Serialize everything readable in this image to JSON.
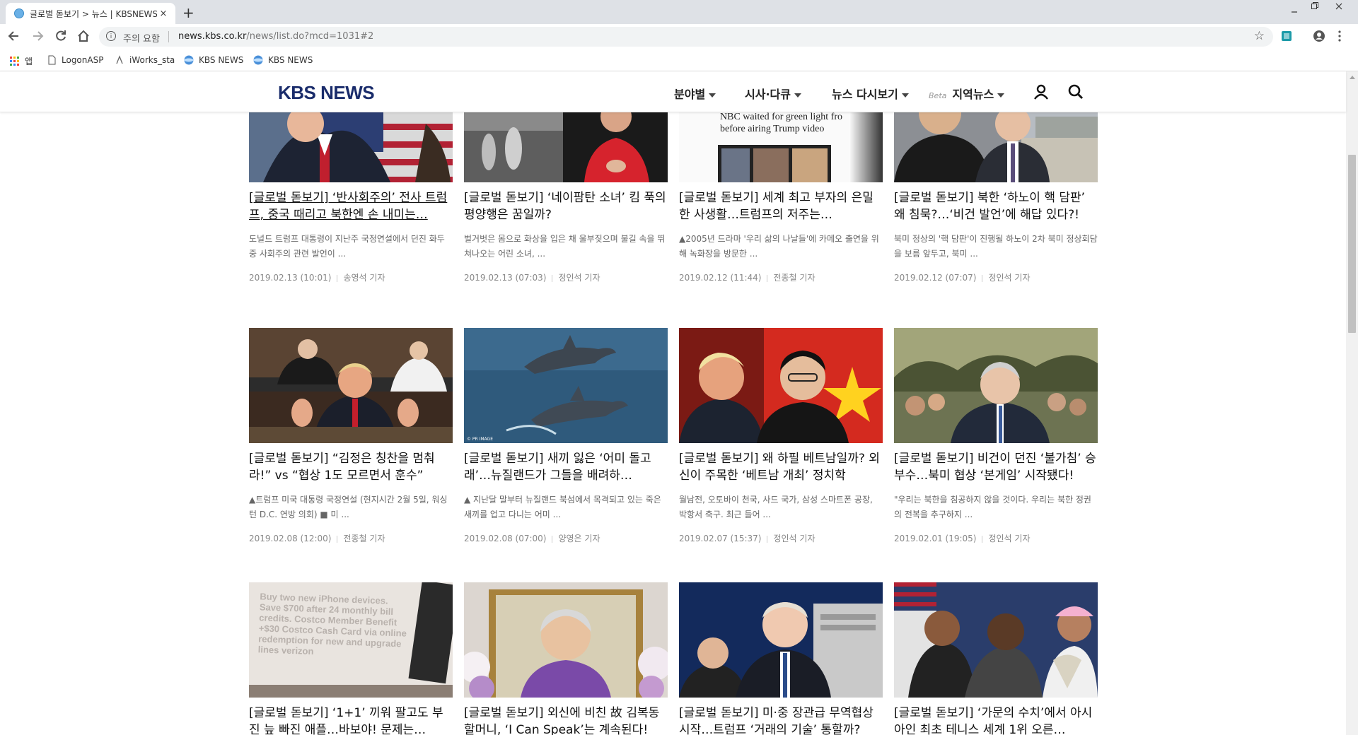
{
  "browser": {
    "tab_title": "글로벌 돋보기 > 뉴스 | KBSNEWS",
    "tab_close": "×",
    "new_tab": "+",
    "security_label": "주의 요함",
    "url_host": "news.kbs.co.kr",
    "url_path": "/news/list.do?mcd=1031#2",
    "bookmarks": [
      {
        "label": "앱",
        "icon": "apps-grid-icon"
      },
      {
        "label": "LogonASP",
        "icon": "page-icon"
      },
      {
        "label": "iWorks_sta",
        "icon": "iworks-icon"
      },
      {
        "label": "KBS NEWS",
        "icon": "kbs-globe-icon"
      },
      {
        "label": "KBS NEWS",
        "icon": "kbs-globe-icon"
      }
    ]
  },
  "site": {
    "logo": "KBS NEWS",
    "menu": [
      {
        "label": "분야별"
      },
      {
        "label": "시사·다큐"
      },
      {
        "label": "뉴스 다시보기"
      },
      {
        "label": "지역뉴스",
        "badge": "Beta"
      }
    ],
    "accent_color": "#1a2c6b"
  },
  "articles": [
    {
      "headline": "[글로벌 돋보기] ‘반사회주의’ 전사 트럼프, 중국 때리고 북한엔 손 내미는…",
      "excerpt": "도널드 트럼프 대통령이 지난주 국정연설에서 던진 화두 중 사회주의 관련 발언이 ...",
      "date": "2019.02.13 (10:01)",
      "reporter": "송영석 기자",
      "underline": true
    },
    {
      "headline": "[글로벌 돋보기] ‘네이팜탄 소녀’ 킴 푹의 평양행은 꿈일까?",
      "excerpt": "벌거벗은 몸으로 화상을 입은 채 울부짖으며 불길 속을 뛰쳐나오는 어린 소녀, ...",
      "date": "2019.02.13 (07:03)",
      "reporter": "정인석 기자",
      "underline": false
    },
    {
      "headline": "[글로벌 돋보기] 세계 최고 부자의 은밀한 사생활…트럼프의 저주는…",
      "excerpt": "▲2005년 드라마 '우리 삶의 나날들'에 카메오 출연을 위해 녹화장을 방문한 ...",
      "date": "2019.02.12 (11:44)",
      "reporter": "전종철 기자",
      "underline": false,
      "photo_text": "NBC waited for green light fro before airing Trump video"
    },
    {
      "headline": "[글로벌 돋보기] 북한 ‘하노이 핵 담판’ 왜 침묵?…‘비건 발언’에 해답 있다?!",
      "excerpt": "북미 정상의 '핵 담판'이 진행될 하노이 2차 북미 정상회담을 보름 앞두고, 북미 ...",
      "date": "2019.02.12 (07:07)",
      "reporter": "정인석 기자",
      "underline": false
    },
    {
      "headline": "[글로벌 돋보기] “김정은 칭찬을 멈춰라!” vs “협상 1도 모르면서 훈수”",
      "excerpt": "▲트럼프 미국 대통령 국정연설 (현지시간 2월 5일, 워싱턴 D.C. 연방 의회) ■ 미 ...",
      "date": "2019.02.08 (12:00)",
      "reporter": "전종철 기자",
      "underline": false
    },
    {
      "headline": "[글로벌 돋보기] 새끼 잃은 ‘어미 돌고래’…뉴질랜드가 그들을 배려하…",
      "excerpt": "▲ 지난달 말부터 뉴질랜드 북섬에서 목격되고 있는 죽은 새끼를 업고 다니는 어미 ...",
      "date": "2019.02.08 (07:00)",
      "reporter": "양영은 기자",
      "underline": false,
      "photo_text": "© PR IMAGE"
    },
    {
      "headline": "[글로벌 돋보기] 왜 하필 베트남일까? 외신이 주목한 ‘베트남 개최’ 정치학",
      "excerpt": "월남전, 오토바이 천국, 사드 국가, 삼성 스마트폰 공장, 박항서 축구. 최근 들어 ...",
      "date": "2019.02.07 (15:37)",
      "reporter": "정인석 기자",
      "underline": false
    },
    {
      "headline": "[글로벌 돋보기] 비건이 던진 ‘불가침’ 승부수…북미 협상 ‘본게임’ 시작됐다!",
      "excerpt": "\"우리는 북한을 침공하지 않을 것이다. 우리는 북한 정권의 전복을 추구하지 ...",
      "date": "2019.02.01 (19:05)",
      "reporter": "정인석 기자",
      "underline": false
    },
    {
      "headline": "[글로벌 돋보기] ‘1+1’ 끼워 팔고도 부진 늪 빠진 애플…바보야! 문제는…",
      "excerpt": "",
      "date": "",
      "reporter": "",
      "underline": false,
      "photo_text": "Buy two new iPhone devices. Save $700 after 24 monthly bill credits. Costco Member Benefit +$30 Costco Cash Card via online redemption for new and upgrade lines verizon"
    },
    {
      "headline": "[글로벌 돋보기] 외신에 비친 故 김복동 할머니, ‘I Can Speak’는 계속된다!",
      "excerpt": "",
      "date": "",
      "reporter": "",
      "underline": false
    },
    {
      "headline": "[글로벌 돋보기] 미·중 장관급 무역협상 시작…트럼프 ‘거래의 기술’ 통할까?",
      "excerpt": "",
      "date": "",
      "reporter": "",
      "underline": false
    },
    {
      "headline": "[글로벌 돋보기] ‘가문의 수치’에서 아시아인 최초 테니스 세계 1위 오른…",
      "excerpt": "",
      "date": "",
      "reporter": "",
      "underline": false
    }
  ]
}
